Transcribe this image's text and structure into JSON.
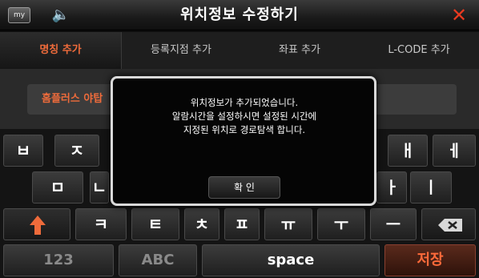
{
  "header": {
    "my_label": "my",
    "speaker_icon": "speaker-icon",
    "title": "위치정보 수정하기",
    "close_icon": "close-icon",
    "close_glyph": "✕",
    "close_color": "#e83a20"
  },
  "tabs": [
    {
      "label": "명칭 추가",
      "active": true
    },
    {
      "label": "등록지점 추가",
      "active": false
    },
    {
      "label": "좌표 추가",
      "active": false
    },
    {
      "label": "L-CODE 추가",
      "active": false
    }
  ],
  "input": {
    "value": "홈플러스 야탑"
  },
  "dialog": {
    "line1": "위치정보가 추가되었습니다.",
    "line2": "알람시간을 설정하시면 설정된 시간에",
    "line3": "지정된 위치로 경로탐색 합니다.",
    "ok_label": "확 인"
  },
  "keyboard": {
    "row1": [
      "ㅂ",
      "ㅈ",
      "ㅐ",
      "ㅔ"
    ],
    "row2": [
      "ㅁ",
      "ㄴ",
      "ㅏ",
      "ㅣ"
    ],
    "row3": [
      "ㅋ",
      "ㅌ",
      "ㅊ",
      "ㅍ",
      "ㅠ",
      "ㅜ",
      "ㅡ"
    ],
    "shift_icon": "up-arrow-icon",
    "backspace_icon": "backspace-icon",
    "num_label": "123",
    "abc_label": "ABC",
    "space_label": "space",
    "save_label": "저장"
  },
  "colors": {
    "accent": "#ee6b3b",
    "dialog_border": "#d9d9d9"
  }
}
